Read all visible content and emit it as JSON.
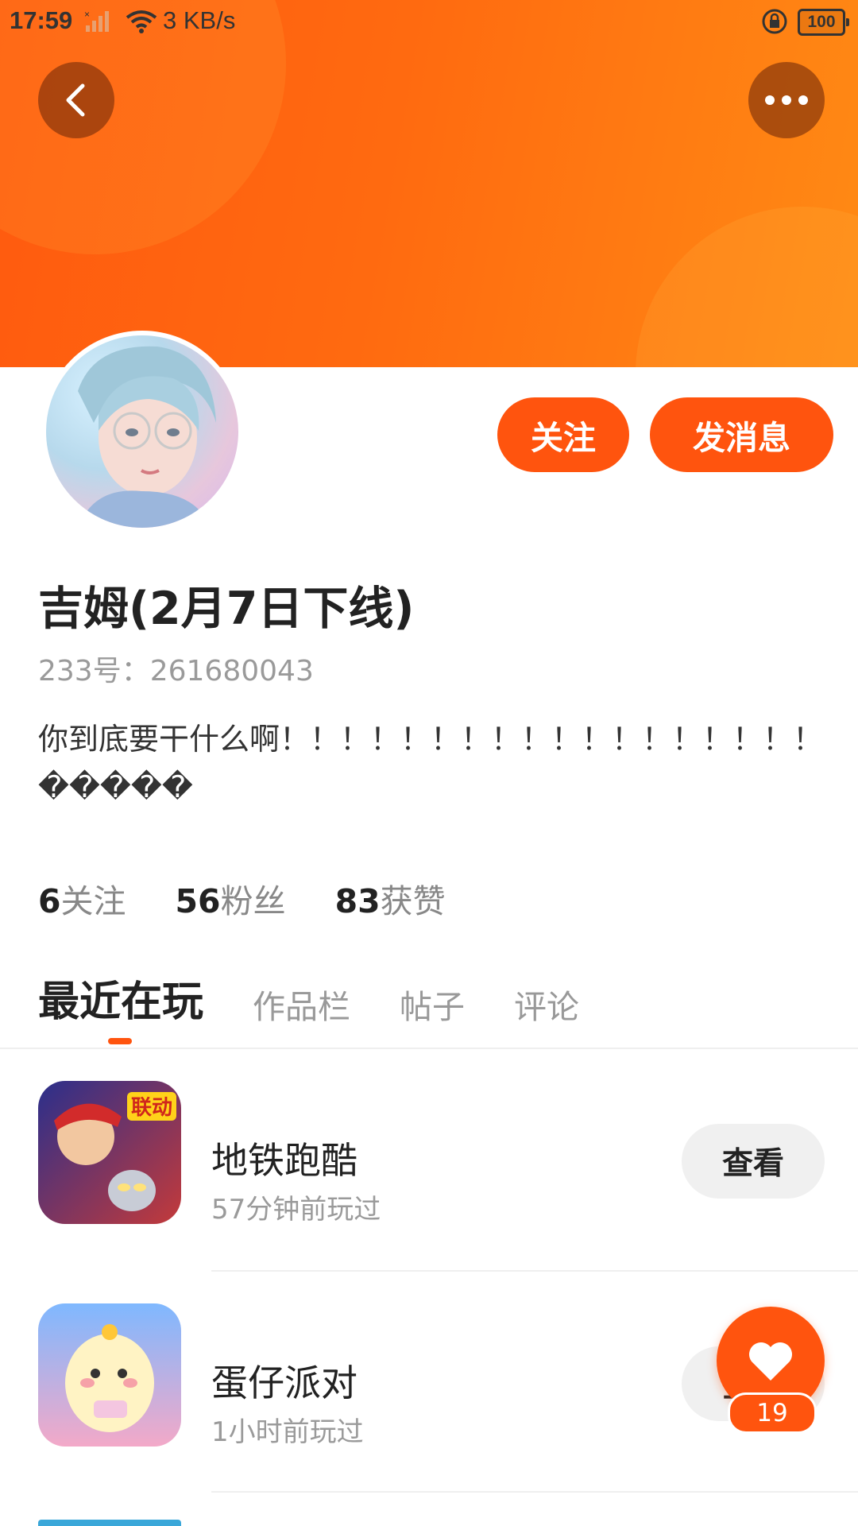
{
  "status_bar": {
    "time": "17:59",
    "speed": "3 KB/s",
    "battery": "100"
  },
  "colors": {
    "accent": "#ff540e",
    "banner_start": "#ff5a0f",
    "banner_end": "#ff8a14"
  },
  "header": {
    "back_icon": "chevron-left-icon",
    "more_icon": "more-dots-icon"
  },
  "profile": {
    "follow_label": "关注",
    "message_label": "发消息",
    "username": "吉姆(2月7日下线)",
    "uid": "233号：261680043",
    "bio": "你到底要干什么啊！！！！！！！！！！！！！！！！！！�����"
  },
  "stats": [
    {
      "num": "6",
      "label": "关注"
    },
    {
      "num": "56",
      "label": "粉丝"
    },
    {
      "num": "83",
      "label": "获赞"
    }
  ],
  "tabs": [
    "最近在玩",
    "作品栏",
    "帖子",
    "评论"
  ],
  "games": [
    {
      "name": "地铁跑酷",
      "time": "57分钟前玩过",
      "button": "查看",
      "badge": "联动"
    },
    {
      "name": "蛋仔派对",
      "time": "1小时前玩过",
      "button": "查看"
    }
  ],
  "like": {
    "count": "19",
    "icon": "heart-icon"
  }
}
